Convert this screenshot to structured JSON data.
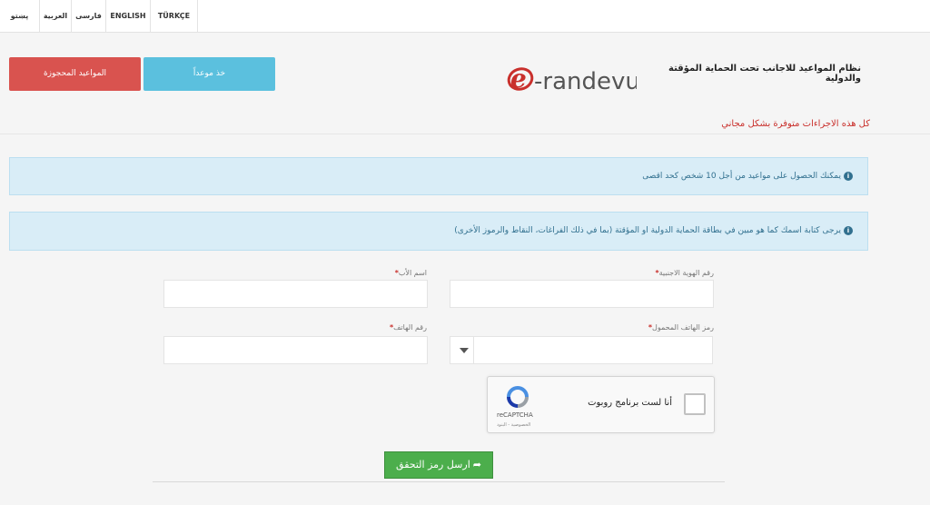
{
  "languages": [
    "پښتو",
    "العربية",
    "فارسی",
    "ENGLISH",
    "TÜRKÇE"
  ],
  "buttons": {
    "reserved": "المواعيد المحجوزة",
    "book": "خذ موعداً"
  },
  "logo": {
    "text": "e-randevu",
    "accent_color": "#c9302c"
  },
  "header": {
    "title": "نظام المواعيد للاجانب تحت الحماية المؤقتة والدولية",
    "free_note": "كل هذه الاجراءات متوفرة بشكل مجاني"
  },
  "alerts": [
    "يمكنك الحصول على مواعيد من أجل 10 شخص كحد اقصى",
    "يرجى كتابة اسمك كما هو مبين في بطاقة الحماية الدولية او المؤقتة (بما في ذلك الفراغات، النقاط والرموز الأخرى)"
  ],
  "form": {
    "foreign_id_label": "رقم الهوية الاجنبية",
    "father_name_label": "اسم الأب",
    "phone_code_label": "رمز الهاتف المحمول",
    "phone_label": "رقم الهاتف",
    "required_mark": "*",
    "phone_code_value": ""
  },
  "captcha": {
    "label": "أنا لست برنامج روبوت",
    "brand": "reCAPTCHA",
    "terms": "الخصوصية - البنود"
  },
  "submit": {
    "label": "ارسل رمز التحقق",
    "arrow": "➦"
  },
  "colors": {
    "danger": "#d9534f",
    "info": "#5bc0de",
    "success": "#4cae4c"
  }
}
